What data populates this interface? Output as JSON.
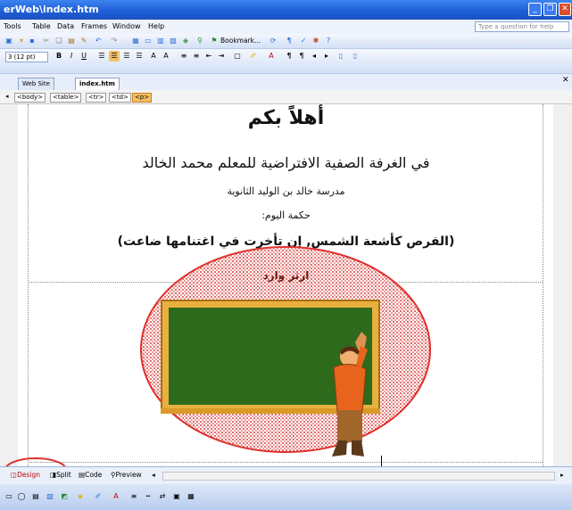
{
  "window": {
    "title": "erWeb\\index.htm"
  },
  "menu": {
    "items": [
      "Tools",
      "Table",
      "Data",
      "Frames",
      "Window",
      "Help"
    ],
    "help_placeholder": "Type a question for help"
  },
  "toolbar": {
    "bookmark_label": "Bookmark...",
    "font_size": "3 (12 pt)",
    "bold": "B",
    "italic": "I",
    "underline": "U"
  },
  "tabs": {
    "website": "Web Site",
    "file": "index.htm"
  },
  "tag_selector": [
    "<body>",
    "<table>",
    "<tr>",
    "<td>",
    "<p>"
  ],
  "page": {
    "heading": "أهلاً بكم",
    "line1": "في الغرفة الصفية الافتراضية للمعلم محمد الخالد",
    "line2": "مدرسة خالد بن الوليد الثانوية",
    "line3": "حكمة اليوم:",
    "quote": "(الفرص كأشعة الشمس, إن تأخرت في اغتنامها ضاعت)",
    "caption": "ارثر وارد"
  },
  "view_tabs": {
    "design": "Design",
    "split": "Split",
    "code": "Code",
    "preview": "Preview"
  },
  "colors": {
    "highlight_ring": "#e0302b",
    "board": "#2e6a1c",
    "frame": "#e8b040",
    "titlebar": "#1f5fd6"
  }
}
